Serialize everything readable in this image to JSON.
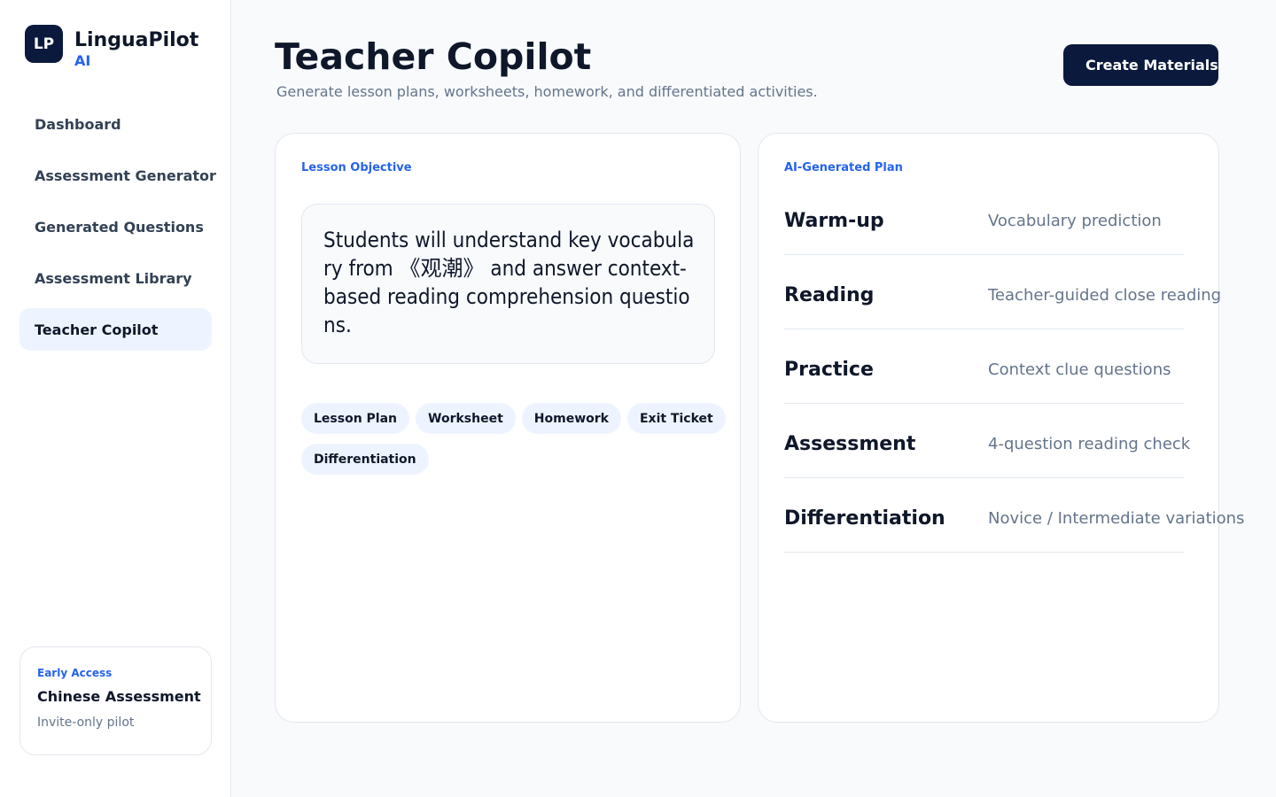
{
  "brand": {
    "mark": "LP",
    "name": "LinguaPilot",
    "sub": "AI"
  },
  "nav": {
    "items": [
      {
        "label": "Dashboard"
      },
      {
        "label": "Assessment Generator"
      },
      {
        "label": "Generated Questions"
      },
      {
        "label": "Assessment Library"
      },
      {
        "label": "Teacher Copilot",
        "active": true
      }
    ]
  },
  "early_access": {
    "label": "Early Access",
    "title": "Chinese Assessment",
    "subtitle": "Invite-only pilot"
  },
  "header": {
    "title": "Teacher Copilot",
    "subtitle": "Generate lesson plans, worksheets, homework, and differentiated activities.",
    "create_label": "Create Materials"
  },
  "objective": {
    "label": "Lesson Objective",
    "text": "Students will understand key vocabulary from 《观潮》 and answer context-based reading comprehension questions."
  },
  "chips": [
    "Lesson Plan",
    "Worksheet",
    "Homework",
    "Exit Ticket",
    "Differentiation"
  ],
  "plan": {
    "label": "AI-Generated Plan",
    "rows": [
      {
        "step": "Warm-up",
        "detail": "Vocabulary prediction"
      },
      {
        "step": "Reading",
        "detail": "Teacher-guided close reading"
      },
      {
        "step": "Practice",
        "detail": "Context clue questions"
      },
      {
        "step": "Assessment",
        "detail": "4-question reading check"
      },
      {
        "step": "Differentiation",
        "detail": "Novice / Intermediate variations"
      }
    ]
  },
  "colors": {
    "accent": "#2563eb",
    "navy": "#0b1a3c",
    "active_bg": "#eef4ff"
  }
}
